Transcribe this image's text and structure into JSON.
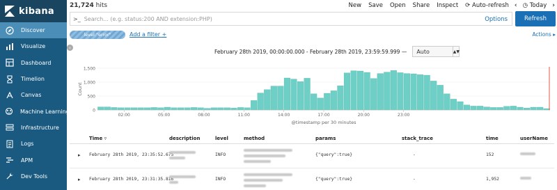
{
  "sidebar": {
    "brand": "kibana",
    "items": [
      {
        "label": "Discover",
        "icon": "compass-icon",
        "active": true
      },
      {
        "label": "Visualize",
        "icon": "bar-chart-icon"
      },
      {
        "label": "Dashboard",
        "icon": "dashboard-icon"
      },
      {
        "label": "Timelion",
        "icon": "timelion-icon"
      },
      {
        "label": "Canvas",
        "icon": "canvas-icon"
      },
      {
        "label": "Machine Learning",
        "icon": "machine-learning-icon"
      },
      {
        "label": "Infrastructure",
        "icon": "infrastructure-icon"
      },
      {
        "label": "Logs",
        "icon": "logs-icon"
      },
      {
        "label": "APM",
        "icon": "apm-icon"
      },
      {
        "label": "Dev Tools",
        "icon": "wrench-icon"
      }
    ]
  },
  "topbar": {
    "hits_count": "21,724",
    "hits_label": "hits",
    "menu": {
      "new": "New",
      "save": "Save",
      "open": "Open",
      "share": "Share",
      "inspect": "Inspect",
      "auto_refresh": "Auto-refresh",
      "today": "Today"
    }
  },
  "query": {
    "prompt": ">_",
    "placeholder": "Search... (e.g. status:200 AND extension:PHP)",
    "value": "",
    "options": "Options",
    "refresh": "Refresh"
  },
  "filters": {
    "pill": "level:\"error\"",
    "add_filter": "Add a filter",
    "actions": "Actions"
  },
  "time_range": {
    "text": "February 28th 2019, 00:00:00.000 - February 28th 2019, 23:59:59.999 —",
    "interval": "Auto"
  },
  "chart_data": {
    "type": "bar",
    "ylabel": "Count",
    "xlabel": "@timestamp per 30 minutes",
    "ylim": [
      0,
      1500
    ],
    "yticks": [
      "1,500",
      "1,000",
      "500",
      "0"
    ],
    "xticks": [
      "02:00",
      "05:00",
      "08:00",
      "11:00",
      "14:00",
      "17:00",
      "20:00",
      "23:00"
    ],
    "color": "#6dcfc5",
    "values": [
      110,
      110,
      90,
      80,
      80,
      80,
      80,
      80,
      90,
      80,
      100,
      80,
      80,
      80,
      90,
      80,
      60,
      80,
      80,
      80,
      70,
      90,
      80,
      340,
      610,
      730,
      860,
      860,
      1150,
      1110,
      1020,
      1140,
      580,
      430,
      600,
      690,
      870,
      1330,
      1410,
      1400,
      1350,
      1130,
      1310,
      1360,
      1420,
      1340,
      1310,
      1300,
      1270,
      1250,
      1040,
      890,
      580,
      390,
      300,
      180,
      140,
      140,
      110,
      90,
      90,
      130,
      140,
      100,
      70,
      100,
      100,
      50
    ]
  },
  "table": {
    "columns": [
      "Time",
      "description",
      "level",
      "method",
      "params",
      "stack_trace",
      "time",
      "userName"
    ],
    "rows": [
      {
        "time": "February 28th 2019, 23:35:52.675",
        "level": "INFO",
        "params": "{\"query\":true}",
        "stack_trace": "-",
        "duration": "152"
      },
      {
        "time": "February 28th 2019, 23:31:35.816",
        "level": "INFO",
        "params": "{\"query\":true}",
        "stack_trace": "-",
        "duration": "1,952"
      }
    ]
  }
}
